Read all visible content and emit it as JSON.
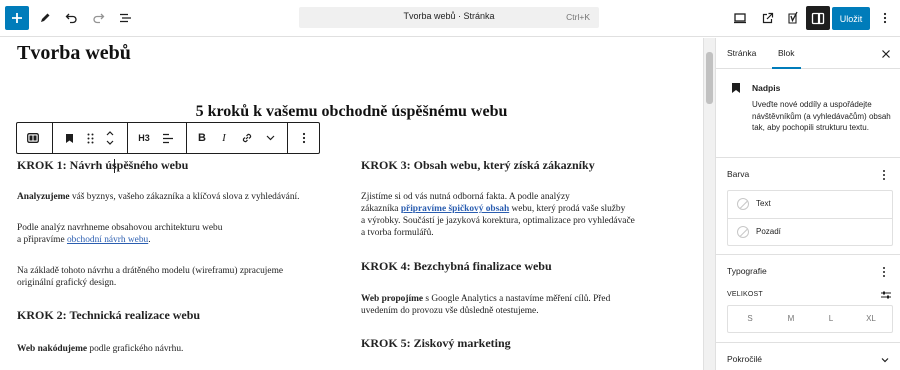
{
  "topbar": {
    "add_icon": "plus-icon",
    "tools_icon": "pencil-icon",
    "undo_icon": "undo-icon",
    "redo_icon": "redo-icon",
    "outline_icon": "document-overview-icon",
    "command": {
      "title": "Tvorba webů · Stránka",
      "shortcut": "Ctrl+K"
    },
    "view_icon": "desktop-icon",
    "preview_icon": "external-link-icon",
    "yoast_icon": "yoast-icon",
    "settings_icon": "sidebar-settings-icon",
    "save_label": "Uložit",
    "options_icon": "more-vertical-icon"
  },
  "canvas": {
    "page_title": "Tvorba webů",
    "main_heading": "5 kroků k vašemu obchodně úspěšnému webu",
    "block_toolbar": {
      "transform_icon": "columns-icon",
      "heading_level": "H3"
    },
    "left_column": {
      "step1_heading": "KROK 1: Návrh úspěšného webu",
      "p1_bold": "Analyzujeme",
      "p1_rest": " váš byznys, vašeho zákazníka a klíčová slova z vyhledávání.",
      "p2_line1": "Podle analýz navrhneme obsahovou architekturu webu",
      "p2_line2_prefix": "a připravíme ",
      "p2_link": "obchodní návrh webu",
      "p2_suffix": ".",
      "p3_line1": "Na základě tohoto návrhu a drátěného modelu (wireframu) zpracujeme",
      "p3_line2": "originální grafický design.",
      "step2_heading": "KROK 2: Technická realizace webu",
      "p4_bold": "Web nakódujeme",
      "p4_rest": " podle grafického návrhu."
    },
    "right_column": {
      "step3_heading": "KROK 3: Obsah webu, který získá zákazníky",
      "p5_line1": "Zjistíme si od vás nutná odborná fakta. A podle analýzy",
      "p5_line2_prefix": "zákazníka ",
      "p5_link": "připravíme špičkový obsah",
      "p5_line2_suffix": " webu, který prodá vaše služby",
      "p5_line3": "a výrobky. Součástí je jazyková korektura, optimalizace pro vyhledávače",
      "p5_line4": "a tvorba formulářů.",
      "step4_heading": "KROK 4: Bezchybná finalizace webu",
      "p6_bold": "Web propojíme",
      "p6_rest": " s Google Analytics a nastavíme měření cílů. Před",
      "p6_line2": "uvedením do provozu vše důsledně otestujeme.",
      "step5_heading": "KROK 5: Ziskový marketing"
    }
  },
  "sidebar": {
    "tabs": [
      "Stránka",
      "Blok"
    ],
    "active_tab": "Blok",
    "block_name": "Nadpis",
    "block_desc": "Uveďte nové oddíly a uspořádejte návštěvníkům (a vyhledávačům) obsah tak, aby pochopili strukturu textu.",
    "color_title": "Barva",
    "color_text": "Text",
    "color_bg": "Pozadí",
    "typo_title": "Typografie",
    "size_label": "VELIKOST",
    "sizes": [
      "S",
      "M",
      "L",
      "XL"
    ],
    "advanced_title": "Pokročilé"
  }
}
